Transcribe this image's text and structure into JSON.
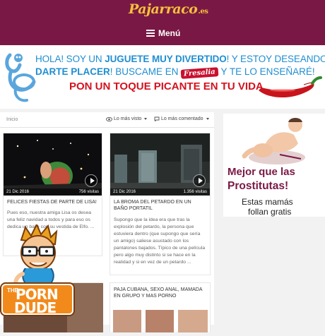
{
  "header": {
    "logo_text": "Pajarraco",
    "logo_ext": ".es",
    "menu_label": "Menú"
  },
  "banner": {
    "line1_a": "HOLA!  SOY UN ",
    "line1_b": "JUGUETE MUY DIVERTIDO",
    "line1_c": "! Y ESTOY DESEANDO",
    "line2_a": "DARTE PLACER",
    "line2_b": "! BUSCAME EN ",
    "brand": "Fresalia",
    "line2_c": " Y TE LO ENSEÑARÉ!",
    "line3": "PON UN TOQUE PICANTE EN TU VIDA"
  },
  "toolbar": {
    "breadcrumb": "Inicio",
    "sort_views": "Lo más visto",
    "sort_comments": "Lo más comentado"
  },
  "videos": [
    {
      "date": "21 Dic 2016",
      "views": "756 visitas",
      "title": "FELICES FIESTAS DE PARTE DE LISA!",
      "desc_lines": [
        "Pues eso, nuestra amiga Lisa os desea",
        "una feliz navidad a todos y para eso os",
        "dedica un baile con su vestida de Elfo.  ..."
      ]
    },
    {
      "date": "21 Dic 2016",
      "views": "1.356 visitas",
      "title": "LA BROMA DEL PETARDO EN UN BAÑO PORTATIL",
      "desc_lines": [
        "Supongo que la idea era que tras la",
        "explosión del petardo, la persona que",
        "estuviera dentro (que supongo que sería",
        "un amigo) saliese asustado con los",
        "pantalones bajados. Típico de una película",
        "pero algo muy distinto si se hace en la",
        "realidad y si en vez de un petardo ..."
      ]
    },
    {
      "title": "PAJA CUBANA, SEXO ANAL, MAMADA EN GRUPO Y MAS PORNO"
    }
  ],
  "side_ad": {
    "line1": "Mejor que las",
    "line2": "Prostitutas!",
    "line3": "Estas mamás",
    "line4": "follan gratis"
  },
  "mascot": {
    "the": "THE",
    "porn": "PORN",
    "dude": "DUDE"
  },
  "colors": {
    "header_bg": "#7a1845",
    "logo": "#f4c23b",
    "banner_blue": "#1f8ed2",
    "banner_red": "#d4121f"
  }
}
